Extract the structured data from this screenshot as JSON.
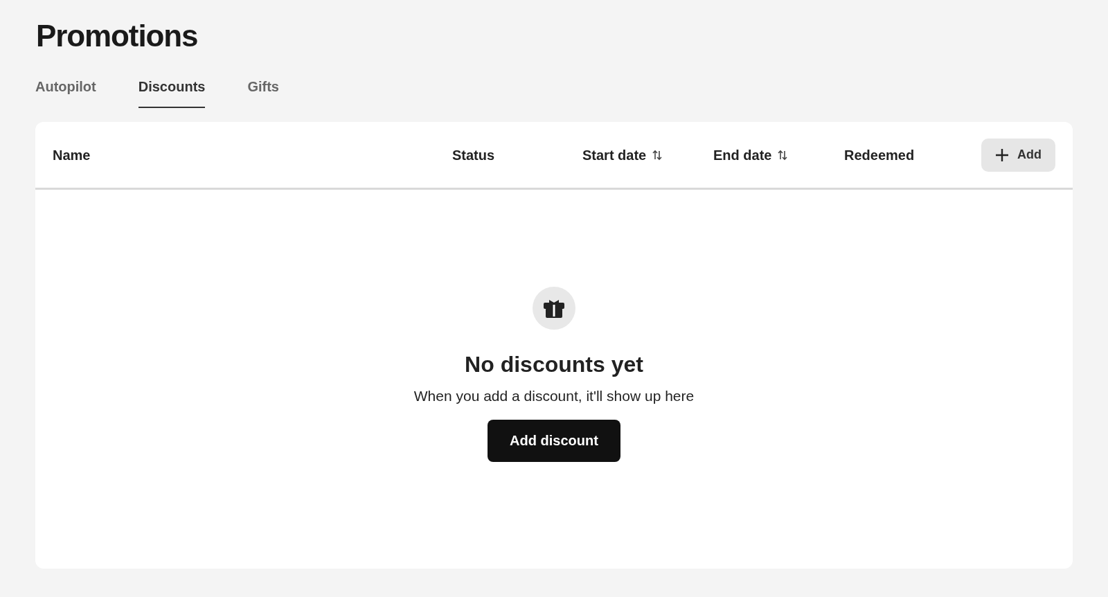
{
  "page": {
    "title": "Promotions"
  },
  "tabs": [
    {
      "label": "Autopilot",
      "selected": false
    },
    {
      "label": "Discounts",
      "selected": true
    },
    {
      "label": "Gifts",
      "selected": false
    }
  ],
  "table": {
    "columns": [
      {
        "label": "Name",
        "sortable": false
      },
      {
        "label": "Status",
        "sortable": false
      },
      {
        "label": "Start date",
        "sortable": true
      },
      {
        "label": "End date",
        "sortable": true
      },
      {
        "label": "Redeemed",
        "sortable": false
      }
    ],
    "add_button": "Add"
  },
  "empty_state": {
    "title": "No discounts yet",
    "message": "When you add a discount, it'll show up here",
    "button": "Add discount"
  }
}
